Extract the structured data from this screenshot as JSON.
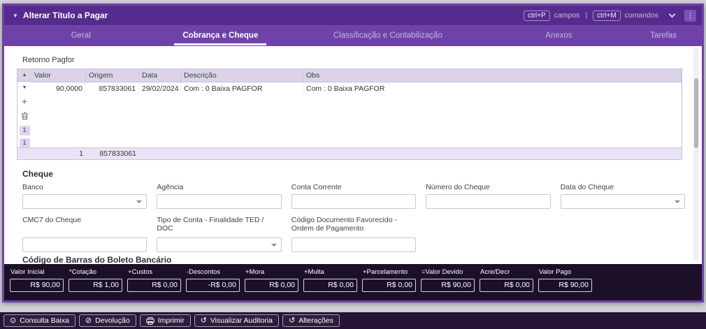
{
  "colors": {
    "brand_purple": "#562b8e",
    "tabbar_purple": "#6f42a7",
    "window_border": "#6f42a7",
    "totals_bar_bg": "#1c1028",
    "footer_bar_bg": "#261536",
    "grid_header_bg": "#dcd3e9",
    "grid_summary_bg": "#eae3f5"
  },
  "icons": {
    "caret_down": "▼",
    "kebab": "⋮",
    "triangle_up": "▲",
    "triangle_down": "▼",
    "plus": "+",
    "history": "↺",
    "consulta": "⊙",
    "devolucao": "⊘"
  },
  "header": {
    "title": "Alterar Título a Pagar",
    "shortcut_fields_key": "ctrl+P",
    "shortcut_fields_label": "campos",
    "separator": "|",
    "shortcut_commands_key": "ctrl+M",
    "shortcut_commands_label": "comandos"
  },
  "tabs": [
    {
      "label": "Geral",
      "active": false
    },
    {
      "label": "Cobrança e Cheque",
      "active": true
    },
    {
      "label": "Classificação e Contabilização",
      "active": false
    },
    {
      "label": "Anexos",
      "active": false
    },
    {
      "label": "Tarefas",
      "active": false
    }
  ],
  "grid": {
    "section_label": "Retorno Pagfor",
    "columns": [
      "Valor",
      "Origem",
      "Data",
      "Descrição",
      "Obs"
    ],
    "row": {
      "valor": "90,0000",
      "origem": "857833061",
      "data": "29/02/2024",
      "descricao": "Com : 0 Baixa PAGFOR",
      "obs": "Com : 0 Baixa PAGFOR"
    },
    "summary": {
      "valor": "1",
      "origem": "857833061"
    },
    "pager_buttons": [
      "1",
      "1"
    ]
  },
  "cheque": {
    "section_label": "Cheque",
    "fields": [
      {
        "label": "Banco",
        "value": "",
        "type": "select"
      },
      {
        "label": "Agência",
        "value": "",
        "type": "text"
      },
      {
        "label": "Conta Corrente",
        "value": "",
        "type": "text"
      },
      {
        "label": "Número do Cheque",
        "value": "",
        "type": "text"
      },
      {
        "label": "Data do Cheque",
        "value": "",
        "type": "select"
      },
      {
        "label": "CMC7 do Cheque",
        "value": "",
        "type": "text"
      },
      {
        "label": "Tipo de Conta - Finalidade TED / DOC",
        "value": "",
        "type": "select"
      },
      {
        "label": "Código Documento Favorecido - Ordem de Pagamento",
        "value": "",
        "type": "text"
      }
    ]
  },
  "barcode_section_label": "Código de Barras do Boleto Bancário",
  "totals": [
    {
      "label": "Valor Inicial",
      "value": "R$ 90,00"
    },
    {
      "label": "*Cotação",
      "value": "R$ 1,00"
    },
    {
      "label": "+Custos",
      "value": "R$ 0,00"
    },
    {
      "label": "-Descontos",
      "value": "-R$ 0,00"
    },
    {
      "label": "+Mora",
      "value": "R$ 0,00"
    },
    {
      "label": "+Multa",
      "value": "R$ 0,00"
    },
    {
      "label": "+Parcelamento",
      "value": "R$ 0,00"
    },
    {
      "label": "=Valor Devido",
      "value": "R$ 90,00"
    },
    {
      "label": "Acre/Decr",
      "value": "R$ 0,00"
    },
    {
      "label": "Valor Pago",
      "value": "R$ 90,00"
    }
  ],
  "footer_buttons": [
    {
      "label": "Consulta Baixa"
    },
    {
      "label": "Devolução"
    },
    {
      "label": "Imprimir"
    },
    {
      "label": "Visualizar Auditoria"
    },
    {
      "label": "Alterações"
    }
  ]
}
